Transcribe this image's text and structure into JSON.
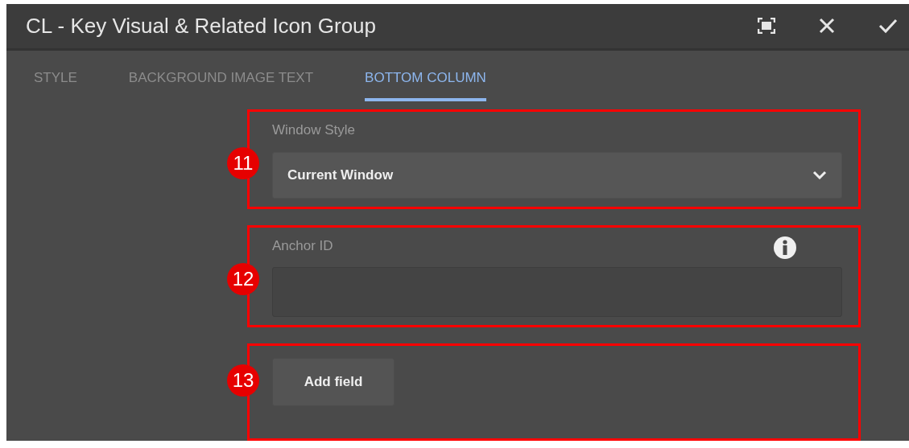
{
  "window": {
    "title": "CL - Key Visual & Related Icon Group"
  },
  "tabs": [
    {
      "label": "STYLE",
      "selected": false
    },
    {
      "label": "BACKGROUND IMAGE TEXT",
      "selected": false
    },
    {
      "label": "BOTTOM COLUMN",
      "selected": true
    }
  ],
  "fields": [
    {
      "kind": "select",
      "annotation": "11",
      "label": "Window Style",
      "value": "Current Window"
    },
    {
      "kind": "text",
      "annotation": "12",
      "label": "Anchor ID",
      "info": true
    },
    {
      "kind": "button",
      "annotation": "13",
      "label": "Add field"
    }
  ]
}
